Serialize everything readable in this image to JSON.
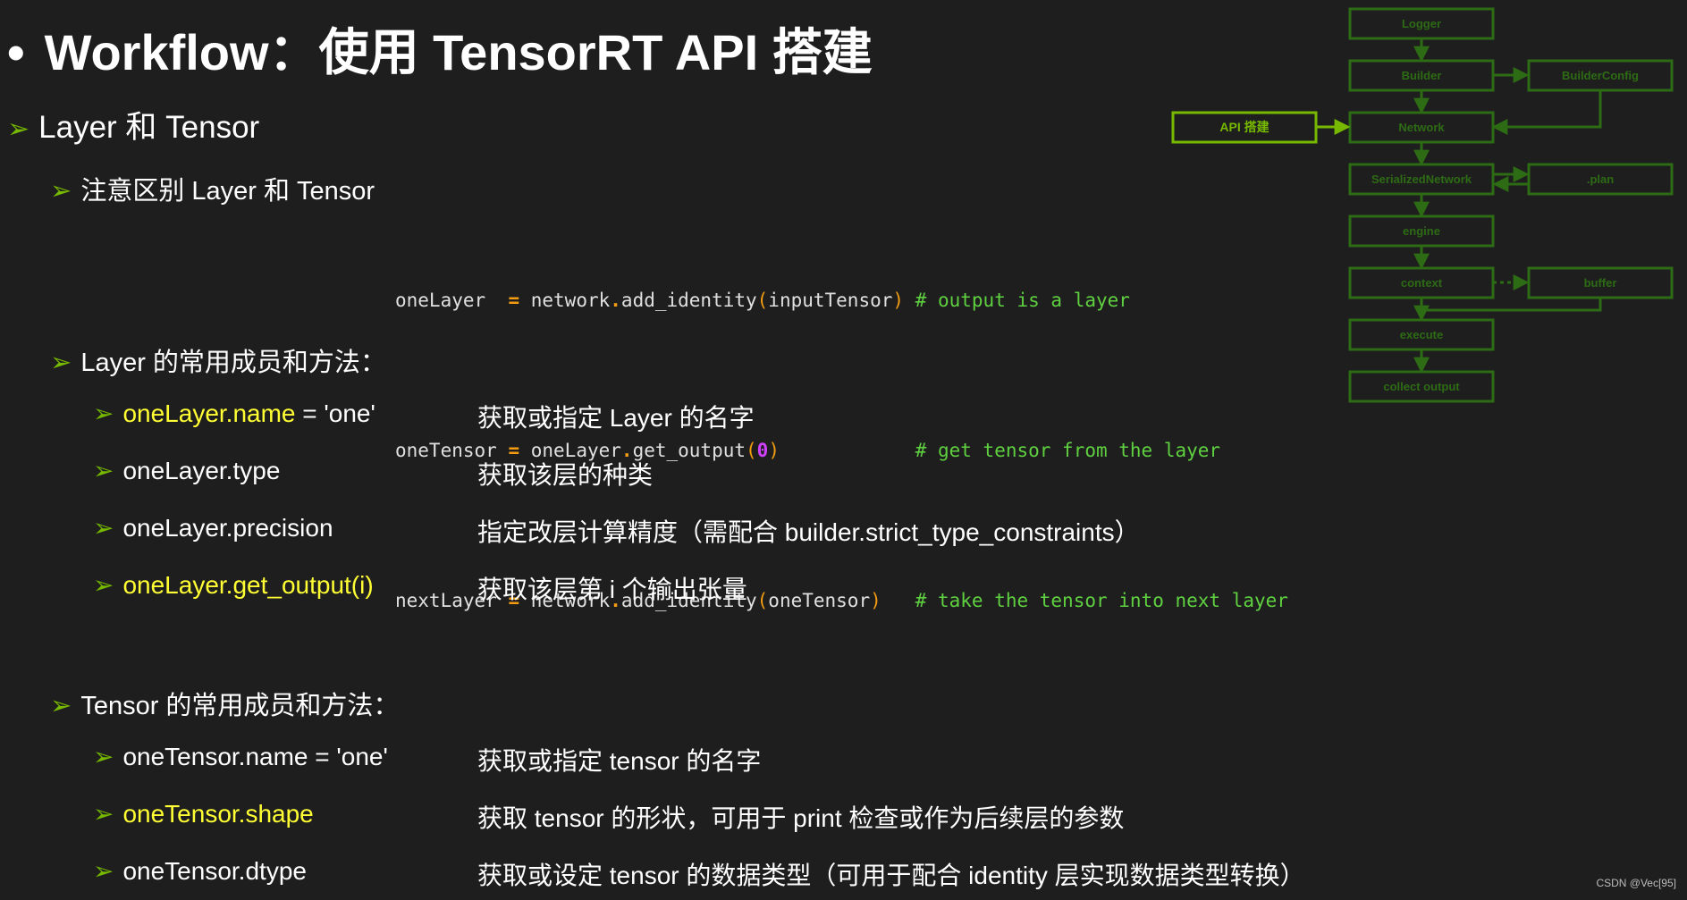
{
  "title": {
    "bullet": "•",
    "text": "Workflow：使用 TensorRT API 搭建"
  },
  "section": {
    "label": "Layer 和 Tensor"
  },
  "note": {
    "label": "注意区别 Layer 和 Tensor",
    "code_lines": [
      {
        "var": "oneLayer  ",
        "op": "=",
        "obj": "network",
        "dot": ".",
        "method": "add_identity",
        "open": "(",
        "arg": "inputTensor",
        "close": ")",
        "pad": " ",
        "comment": "# output is a layer"
      },
      {
        "var": "oneTensor ",
        "op": "=",
        "obj": "oneLayer",
        "dot": ".",
        "method": "get_output",
        "open": "(",
        "arg": "0",
        "close": ")",
        "pad": "            ",
        "comment": "# get tensor from the layer"
      },
      {
        "var": "nextLayer ",
        "op": "=",
        "obj": "network",
        "dot": ".",
        "method": "add_identity",
        "open": "(",
        "arg": "oneTensor",
        "close": ")",
        "pad": "   ",
        "comment": "# take the tensor into next layer"
      }
    ]
  },
  "layer_section": {
    "label": "Layer 的常用成员和方法：",
    "items": [
      {
        "code": "oneLayer.name",
        "rest": " = 'one'",
        "desc": "获取或指定 Layer 的名字"
      },
      {
        "code": "",
        "rest": "oneLayer.type",
        "desc": "获取该层的种类"
      },
      {
        "code": "",
        "rest": "oneLayer.precision",
        "desc": "指定改层计算精度（需配合 builder.strict_type_constraints）"
      },
      {
        "code": "oneLayer.get_output(i)",
        "rest": "",
        "desc": "获取该层第 i 个输出张量"
      }
    ]
  },
  "tensor_section": {
    "label": "Tensor 的常用成员和方法：",
    "items": [
      {
        "code": "",
        "rest": "oneTensor.name = 'one'",
        "desc": "获取或指定 tensor 的名字"
      },
      {
        "code": "oneTensor.shape",
        "rest": "",
        "desc": "获取 tensor 的形状，可用于 print 检查或作为后续层的参数"
      },
      {
        "code": "",
        "rest": "oneTensor.dtype",
        "desc": "获取或设定 tensor 的数据类型（可用于配合 identity 层实现数据类型转换）"
      }
    ]
  },
  "diagram": {
    "nodes": {
      "logger": "Logger",
      "builder": "Builder",
      "builder_config": "BuilderConfig",
      "network": "Network",
      "api": "API 搭建",
      "serialized": "SerializedNetwork",
      "plan": ".plan",
      "engine": "engine",
      "context": "context",
      "buffer": "buffer",
      "execute": "execute",
      "collect": "collect output"
    },
    "colors": {
      "dim": "#2d6b14",
      "bright": "#76b900"
    }
  },
  "watermark": "CSDN @Vec[95]"
}
